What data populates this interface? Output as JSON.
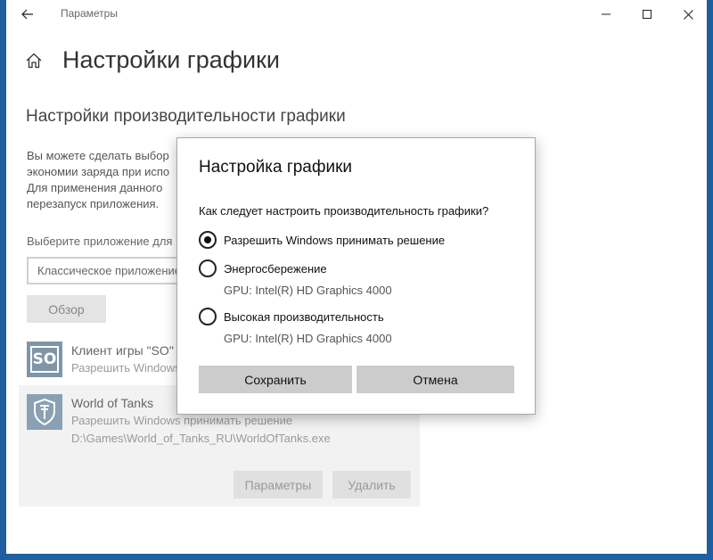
{
  "window": {
    "title": "Параметры"
  },
  "page": {
    "title": "Настройки графики",
    "section_title": "Настройки производительности графики",
    "description": "Вы можете сделать выбор экономии заряда при испо Для применения данного перезапуск приложения.",
    "select_label": "Выберите приложение для",
    "app_type_value": "Классическое приложение",
    "browse_label": "Обзор"
  },
  "apps": [
    {
      "name": "Клиент игры \"SO\"",
      "preference": "Разрешить Windows",
      "logo_text": "SO"
    },
    {
      "name": "World of Tanks",
      "preference": "Разрешить Windows принимать решение",
      "path": "D:\\Games\\World_of_Tanks_RU\\WorldOfTanks.exe",
      "params_label": "Параметры",
      "delete_label": "Удалить"
    }
  ],
  "dialog": {
    "title": "Настройка графики",
    "question": "Как следует настроить производительность графики?",
    "options": [
      {
        "label": "Разрешить Windows принимать решение",
        "checked": true
      },
      {
        "label": "Энергосбережение",
        "gpu": "GPU: Intel(R) HD Graphics 4000",
        "checked": false
      },
      {
        "label": "Высокая производительность",
        "gpu": "GPU: Intel(R) HD Graphics 4000",
        "checked": false
      }
    ],
    "save_label": "Сохранить",
    "cancel_label": "Отмена"
  },
  "colors": {
    "desktop": "#1f5f9f",
    "button_gray": "#cccccc",
    "selected_item_bg": "#f2f2f2"
  },
  "icons": [
    "back-arrow-icon",
    "home-icon",
    "minimize-icon",
    "maximize-icon",
    "close-icon",
    "wot-logo-icon"
  ]
}
